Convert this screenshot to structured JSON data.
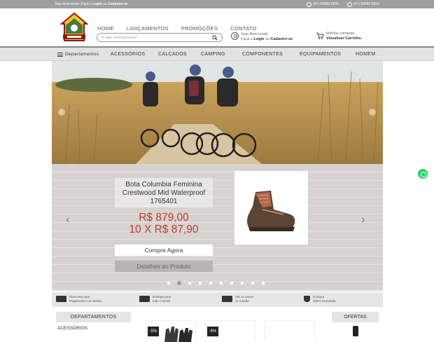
{
  "topbar": {
    "welcome_prefix": "Seja bem-vindo. Faça o",
    "login": "Login",
    "or": "ou",
    "register": "Cadastre-se",
    "phone1": "(47) 99660-6555",
    "phone2": "(47) 99489-6555"
  },
  "nav": {
    "home": "HOME",
    "launches": "LANÇAMENTOS",
    "promos": "PROMOÇÕES",
    "contact": "CONTATO"
  },
  "search": {
    "placeholder": "O que você procura?"
  },
  "account": {
    "line1": "Seja Bem-vindo",
    "line2_prefix": "Faça o",
    "login": "Login",
    "or": "ou",
    "register": "Cadastre-se"
  },
  "cart": {
    "line1": "Minhas compras",
    "line2": "Visualizar Carrinho",
    "count": "0"
  },
  "categories": {
    "departments": "Departamentos",
    "items": [
      "ACESSÓRIOS",
      "CALÇADOS",
      "CAMPING",
      "COMPONENTES",
      "EQUIPAMENTOS",
      "HOMEM"
    ]
  },
  "product": {
    "title": "Bota Columbia Feminina Crestwood Mid Waterproof 1765401",
    "price": "R$ 879,00",
    "installments": "10 X R$ 87,90",
    "buy_label": "Compre Agora",
    "details_label": "Detalhes do Produto"
  },
  "slider": {
    "dot_count": 10,
    "active_dot": 1
  },
  "benefits": [
    {
      "line1": "Desconto para",
      "line2": "Pagamento com Boleto",
      "icon": "barcode-icon"
    },
    {
      "line1": "Entrega para",
      "line2": "todo o Brasil",
      "icon": "truck-icon"
    },
    {
      "line1": "Até 12 vezes",
      "line2": "no Cartão",
      "icon": "credit-card-icon"
    },
    {
      "line1": "Compra",
      "line2": "100% Garantida",
      "icon": "shield-icon"
    }
  ],
  "sidebar": {
    "title": "DEPARTAMENTOS",
    "first_item": "ACESSÓRIOS"
  },
  "offers": {
    "title": "OFERTAS"
  },
  "cards": [
    {
      "discount": "-5%"
    },
    {
      "discount": "-6%"
    }
  ],
  "colors": {
    "price": "#c0392b",
    "topbar": "#9e9e9e",
    "whatsapp": "#25d366"
  }
}
